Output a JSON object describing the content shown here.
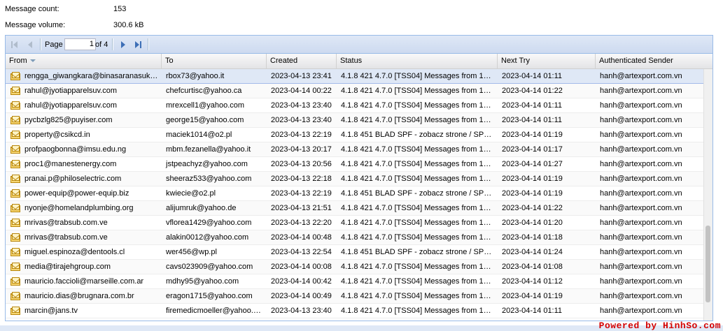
{
  "summary": {
    "message_count_label": "Message count:",
    "message_count_value": "153",
    "message_volume_label": "Message volume:",
    "message_volume_value": "300.6 kB"
  },
  "pager": {
    "page_label": "Page",
    "page_value": "1",
    "of_label": "of 4"
  },
  "columns": [
    "From",
    "To",
    "Created",
    "Status",
    "Next Try",
    "Authenticated Sender"
  ],
  "sort_column": "From",
  "rows": [
    [
      "rengga_giwangkara@binasaranasuk…",
      "rbox73@yahoo.it",
      "2023-04-13 23:41",
      "4.1.8 421 4.7.0 [TSS04] Messages from 1…",
      "2023-04-14 01:11",
      "hanh@artexport.com.vn"
    ],
    [
      "rahul@jyotiapparelsuv.com",
      "chefcurtisc@yahoo.ca",
      "2023-04-14 00:22",
      "4.1.8 421 4.7.0 [TSS04] Messages from 1…",
      "2023-04-14 01:22",
      "hanh@artexport.com.vn"
    ],
    [
      "rahul@jyotiapparelsuv.com",
      "mrexcell1@yahoo.com",
      "2023-04-13 23:40",
      "4.1.8 421 4.7.0 [TSS04] Messages from 1…",
      "2023-04-14 01:11",
      "hanh@artexport.com.vn"
    ],
    [
      "pycbzlg825@puyiser.com",
      "george15@yahoo.com",
      "2023-04-13 23:40",
      "4.1.8 421 4.7.0 [TSS04] Messages from 1…",
      "2023-04-14 01:11",
      "hanh@artexport.com.vn"
    ],
    [
      "property@csikcd.in",
      "maciek1014@o2.pl",
      "2023-04-13 22:19",
      "4.1.8 451 BLAD SPF - zobacz strone / SP…",
      "2023-04-14 01:19",
      "hanh@artexport.com.vn"
    ],
    [
      "profpaogbonna@imsu.edu.ng",
      "mbm.fezanella@yahoo.it",
      "2023-04-13 20:17",
      "4.1.8 421 4.7.0 [TSS04] Messages from 1…",
      "2023-04-14 01:17",
      "hanh@artexport.com.vn"
    ],
    [
      "proc1@manestenergy.com",
      "jstpeachyz@yahoo.com",
      "2023-04-13 20:56",
      "4.1.8 421 4.7.0 [TSS04] Messages from 1…",
      "2023-04-14 01:27",
      "hanh@artexport.com.vn"
    ],
    [
      "pranai.p@philoselectric.com",
      "sheeraz533@yahoo.com",
      "2023-04-13 22:18",
      "4.1.8 421 4.7.0 [TSS04] Messages from 1…",
      "2023-04-14 01:19",
      "hanh@artexport.com.vn"
    ],
    [
      "power-equip@power-equip.biz",
      "kwiecie@o2.pl",
      "2023-04-13 22:19",
      "4.1.8 451 BLAD SPF - zobacz strone / SP…",
      "2023-04-14 01:19",
      "hanh@artexport.com.vn"
    ],
    [
      "nyonje@homelandplumbing.org",
      "alijumruk@yahoo.de",
      "2023-04-13 21:51",
      "4.1.8 421 4.7.0 [TSS04] Messages from 1…",
      "2023-04-14 01:22",
      "hanh@artexport.com.vn"
    ],
    [
      "mrivas@trabsub.com.ve",
      "vflorea1429@yahoo.com",
      "2023-04-13 22:20",
      "4.1.8 421 4.7.0 [TSS04] Messages from 1…",
      "2023-04-14 01:20",
      "hanh@artexport.com.vn"
    ],
    [
      "mrivas@trabsub.com.ve",
      "alakin0012@yahoo.com",
      "2023-04-14 00:48",
      "4.1.8 421 4.7.0 [TSS04] Messages from 1…",
      "2023-04-14 01:18",
      "hanh@artexport.com.vn"
    ],
    [
      "miguel.espinoza@dentools.cl",
      "wer456@wp.pl",
      "2023-04-13 22:54",
      "4.1.8 451 BLAD SPF - zobacz strone / SP…",
      "2023-04-14 01:24",
      "hanh@artexport.com.vn"
    ],
    [
      "media@tirajehgroup.com",
      "cavs023909@yahoo.com",
      "2023-04-14 00:08",
      "4.1.8 421 4.7.0 [TSS04] Messages from 1…",
      "2023-04-14 01:08",
      "hanh@artexport.com.vn"
    ],
    [
      "mauricio.faccioli@marseille.com.ar",
      "mdhy95@yahoo.com",
      "2023-04-14 00:42",
      "4.1.8 421 4.7.0 [TSS04] Messages from 1…",
      "2023-04-14 01:12",
      "hanh@artexport.com.vn"
    ],
    [
      "mauricio.dias@brugnara.com.br",
      "eragon1715@yahoo.com",
      "2023-04-14 00:49",
      "4.1.8 421 4.7.0 [TSS04] Messages from 1…",
      "2023-04-14 01:19",
      "hanh@artexport.com.vn"
    ],
    [
      "marcin@jans.tv",
      "firemedicmoeller@yahoo.…",
      "2023-04-13 23:40",
      "4.1.8 421 4.7.0 [TSS04] Messages from 1…",
      "2023-04-14 01:11",
      "hanh@artexport.com.vn"
    ]
  ],
  "icons": {
    "first": "first-page-icon",
    "prev": "prev-page-icon",
    "next": "next-page-icon",
    "last": "last-page-icon",
    "row": "mail-queue-icon"
  },
  "powered_by": "Powered by HinhSo.com",
  "colors": {
    "accent_blue": "#99bbe8",
    "selected_row": "#dfe8f6",
    "powered_red": "#d40000"
  }
}
